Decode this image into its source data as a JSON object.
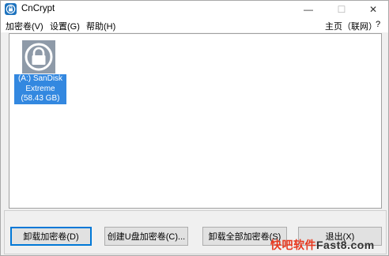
{
  "window": {
    "title": "CnCrypt"
  },
  "title_controls": {
    "minimize": "—",
    "maximize": "☐",
    "close": "✕"
  },
  "menu": {
    "items": [
      "加密卷(V)",
      "设置(G)",
      "帮助(H)"
    ],
    "home": "主页（联网）",
    "help_q": "?"
  },
  "volumes": [
    {
      "label": "(A:) SanDisk Extreme (58.43 GB)",
      "icon": "lock-icon"
    }
  ],
  "buttons": {
    "dismount": "卸载加密卷(D)",
    "create_usb": "创建U盘加密卷(C)...",
    "dismount_all": "卸载全部加密卷(S)",
    "exit": "退出(X)"
  },
  "watermark": {
    "part1": "快吧软件",
    "part2": "Fast8.com"
  },
  "colors": {
    "accent": "#0078d7",
    "selection": "#3388e0",
    "icon_bg": "#8e9aa8"
  }
}
